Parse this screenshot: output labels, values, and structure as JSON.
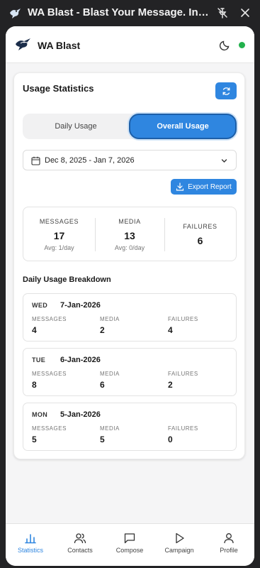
{
  "window": {
    "title": "WA Blast - Blast Your Message. Instantly."
  },
  "header": {
    "app_name": "WA Blast",
    "status_color": "#22b14c"
  },
  "stats": {
    "title": "Usage Statistics",
    "toggle": {
      "daily_label": "Daily Usage",
      "overall_label": "Overall Usage",
      "selected": "Overall Usage"
    },
    "date_range": "Dec 8, 2025 - Jan 7, 2026",
    "export_label": "Export Report",
    "summary": [
      {
        "label": "MESSAGES",
        "value": "17",
        "avg": "Avg: 1/day"
      },
      {
        "label": "MEDIA",
        "value": "13",
        "avg": "Avg: 0/day"
      },
      {
        "label": "FAILURES",
        "value": "6"
      }
    ],
    "breakdown_title": "Daily Usage Breakdown",
    "days": [
      {
        "day": "WED",
        "date": "7-Jan-2026",
        "messages_label": "MESSAGES",
        "messages": "4",
        "media_label": "MEDIA",
        "media": "2",
        "failures_label": "FAILURES",
        "failures": "4"
      },
      {
        "day": "TUE",
        "date": "6-Jan-2026",
        "messages_label": "MESSAGES",
        "messages": "8",
        "media_label": "MEDIA",
        "media": "6",
        "failures_label": "FAILURES",
        "failures": "2"
      },
      {
        "day": "MON",
        "date": "5-Jan-2026",
        "messages_label": "MESSAGES",
        "messages": "5",
        "media_label": "MEDIA",
        "media": "5",
        "failures_label": "FAILURES",
        "failures": "0"
      }
    ]
  },
  "nav": {
    "active": "Statistics",
    "items": [
      {
        "label": "Statistics",
        "icon": "bar-chart-icon"
      },
      {
        "label": "Contacts",
        "icon": "users-icon"
      },
      {
        "label": "Compose",
        "icon": "message-square-icon"
      },
      {
        "label": "Campaign",
        "icon": "play-icon"
      },
      {
        "label": "Profile",
        "icon": "user-icon"
      }
    ]
  },
  "colors": {
    "accent": "#2f86e0",
    "online": "#22b14c"
  }
}
